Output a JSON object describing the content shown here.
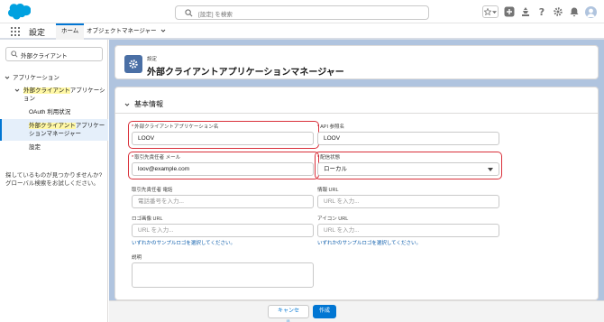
{
  "header": {
    "search_placeholder": "[設定] を検索",
    "icons": [
      "favorites-star-icon",
      "favorites-list-icon",
      "global-actions-icon",
      "trailhead-icon",
      "help-icon",
      "setup-gear-icon",
      "notification-bell-icon",
      "user-avatar"
    ]
  },
  "nav": {
    "app_name": "設定",
    "tabs": [
      {
        "label": "ホーム",
        "active": true
      },
      {
        "label": "オブジェクトマネージャー",
        "has_menu": true
      }
    ]
  },
  "sidebar": {
    "quick_find_value": "外部クライアント",
    "tree": [
      {
        "label": "アプリケーション",
        "level": 0,
        "expanded": true
      },
      {
        "label_parts": [
          "外部クライアント",
          "アプリケーション"
        ],
        "highlight_part": 0,
        "level": 1,
        "expanded": true
      },
      {
        "label": "OAuth 利用状況",
        "level": 2
      },
      {
        "label_parts": [
          "外部クライアント",
          "アプリケーションマネージャー"
        ],
        "highlight_part": 0,
        "level": 2,
        "selected": true
      },
      {
        "label": "設定",
        "level": 2
      }
    ],
    "help_text": "探しているものが見つかりませんか? グローバル検索をお試しください。"
  },
  "page_header": {
    "kicker": "設定",
    "title": "外部クライアントアプリケーションマネージャー",
    "icon": "setup-gear-icon"
  },
  "form": {
    "section_title": "基本情報",
    "fields": {
      "app_name": {
        "label": "外部クライアントアプリケーション名",
        "required": true,
        "value": "LOOV"
      },
      "api_name": {
        "label": "API 参照名",
        "required": true,
        "value": "LOOV"
      },
      "contact_email": {
        "label": "取引先責任者 メール",
        "required": true,
        "value": "loov@example.com"
      },
      "distribution_state": {
        "label": "配信状態",
        "required": true,
        "value": "ローカル"
      },
      "contact_phone": {
        "label": "取引先責任者 電話",
        "placeholder": "電話番号を入力..."
      },
      "info_url": {
        "label": "情報 URL",
        "placeholder": "URL を入力..."
      },
      "logo_url": {
        "label": "ロゴ画像 URL",
        "placeholder": "URL を入力...",
        "link": "いずれかのサンプルロゴを選択してください。"
      },
      "icon_url": {
        "label": "アイコン URL",
        "placeholder": "URL を入力...",
        "link": "いずれかのサンプルロゴを選択してください。"
      },
      "description": {
        "label": "説明"
      }
    }
  },
  "footer": {
    "cancel_label": "キャンセル",
    "create_label": "作成"
  },
  "colors": {
    "brand_blue": "#0176d3",
    "highlight_ring": "#d9303a",
    "search_highlight": "#fff8a6",
    "main_background": "#b0c4df"
  }
}
